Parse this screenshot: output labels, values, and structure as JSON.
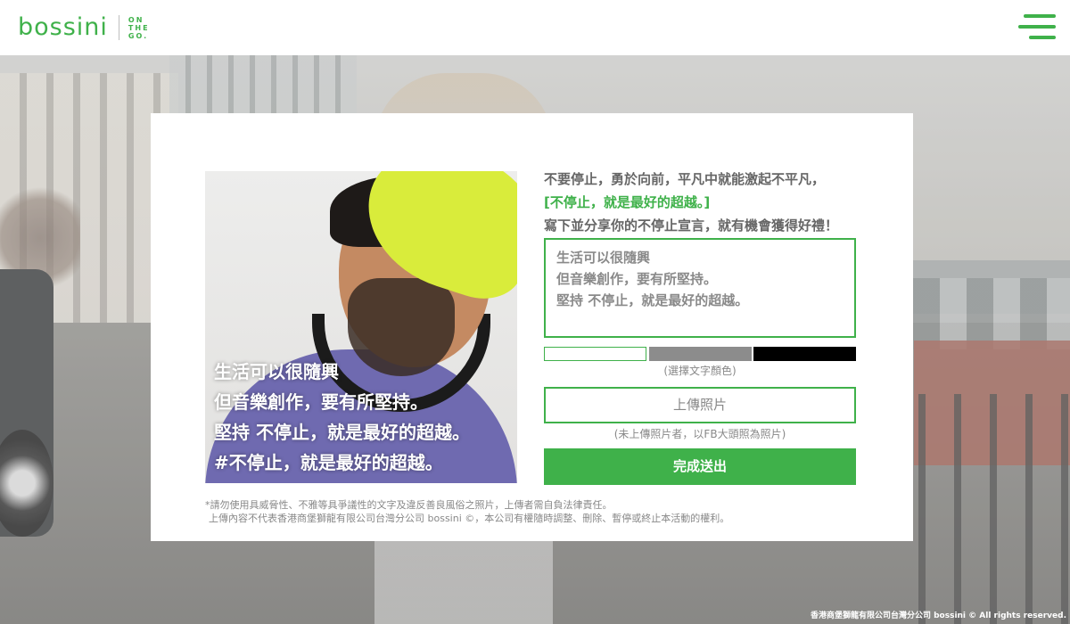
{
  "brand": {
    "name": "bossini",
    "tagline": [
      "ON",
      "THE",
      "GO."
    ],
    "accent_color": "#3fb14a"
  },
  "header": {
    "menu_icon": "hamburger-icon"
  },
  "modal": {
    "photo_caption": [
      "生活可以很隨興",
      "但音樂創作，要有所堅持。",
      "堅持 不停止，就是最好的超越。",
      "#不停止，就是最好的超越。"
    ],
    "intro_line1": "不要停止，勇於向前，平凡中就能激起不平凡，",
    "intro_line2": "[不停止，就是最好的超越。]",
    "intro_line3": "寫下並分享你的不停止宣言，就有機會獲得好禮！",
    "declaration_lines": [
      "生活可以很隨興",
      "但音樂創作，要有所堅持。",
      "堅持 不停止，就是最好的超越。"
    ],
    "color_options": [
      "#ffffff",
      "#8c8c8c",
      "#000000"
    ],
    "color_hint": "(選擇文字顏色)",
    "upload_label": "上傳照片",
    "upload_hint": "(未上傳照片者，以FB大頭照為照片)",
    "submit_label": "完成送出",
    "disclaimer_1": "*請勿使用具威脅性、不雅等具爭議性的文字及違反善良風俗之照片，上傳者需自負法律責任。",
    "disclaimer_2": "上傳內容不代表香港商堡獅龍有限公司台灣分公司 bossini ©，本公司有權隨時調整、刪除、暫停或終止本活動的權利。"
  },
  "footer": {
    "credit": "香港商堡獅龍有限公司台灣分公司 bossini © All rights reserved."
  }
}
